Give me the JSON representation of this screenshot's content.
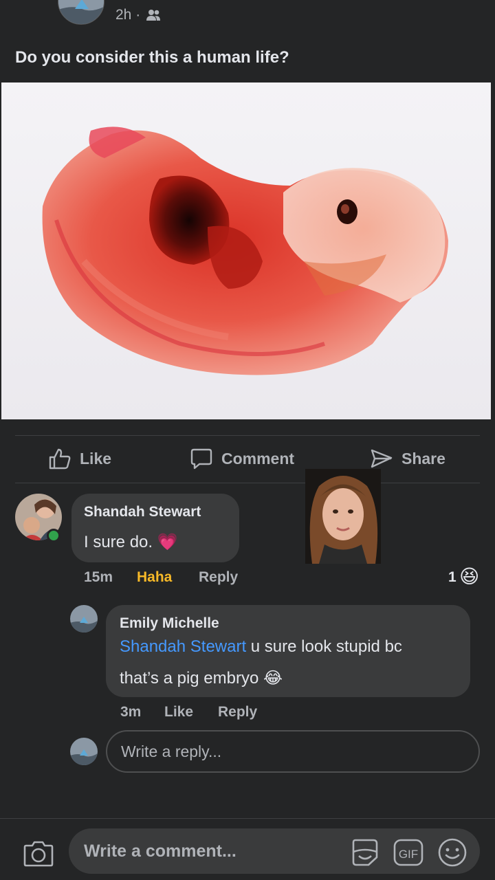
{
  "post": {
    "time": "2h ·",
    "text": "Do you consider this a human life?"
  },
  "actions": {
    "like": "Like",
    "comment": "Comment",
    "share": "Share"
  },
  "comments": [
    {
      "author": "Shandah Stewart",
      "text": "I sure do.",
      "emoji": "💗",
      "time": "15m",
      "reaction_label": "Haha",
      "reply_label": "Reply",
      "reaction_count": "1",
      "reaction_emoji": "😆"
    }
  ],
  "replies": [
    {
      "author": "Emily Michelle",
      "mention": "Shandah Stewart",
      "text_line1": " u sure look stupid bc",
      "text_line2": "that’s a pig embryo",
      "emoji": "😂",
      "time": "3m",
      "like_label": "Like",
      "reply_label": "Reply"
    }
  ],
  "reply_input": {
    "placeholder": "Write a reply..."
  },
  "comment_input": {
    "placeholder": "Write a comment..."
  },
  "colors": {
    "background": "#242526",
    "bubble": "#3a3b3c",
    "haha_accent": "#f7b928",
    "mention": "#4599ff",
    "online": "#31a24c"
  },
  "icons": {
    "back": "back-chevron-icon",
    "more": "more-dots-icon",
    "audience": "friends-icon",
    "like": "thumbs-up-icon",
    "comment": "speech-bubble-icon",
    "share": "share-arrow-icon",
    "camera": "camera-icon",
    "sticker": "sticker-icon",
    "gif": "gif-icon",
    "emoji": "smiley-icon"
  }
}
